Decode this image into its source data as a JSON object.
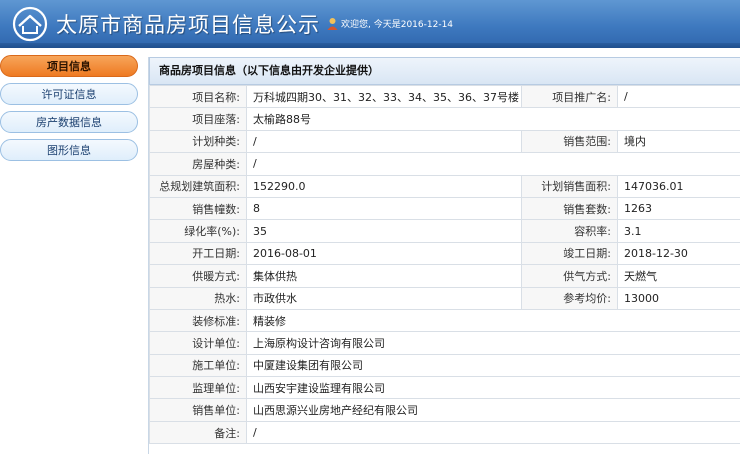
{
  "header": {
    "site_title": "太原市商品房项目信息公示",
    "welcome": "欢迎您, 今天是2016-12-14",
    "logo_icon": "house-circle-icon",
    "user_icon": "user-icon"
  },
  "sidebar": {
    "items": [
      {
        "label": "项目信息",
        "active": true
      },
      {
        "label": "许可证信息",
        "active": false
      },
      {
        "label": "房产数据信息",
        "active": false
      },
      {
        "label": "图形信息",
        "active": false
      }
    ]
  },
  "section": {
    "title": "商品房项目信息（以下信息由开发企业提供）"
  },
  "fields": {
    "project_name": {
      "label": "项目名称:",
      "value": "万科城四期30、31、32、33、34、35、36、37号楼"
    },
    "promo_name": {
      "label": "项目推广名:",
      "value": "/"
    },
    "location": {
      "label": "项目座落:",
      "value": "太榆路88号"
    },
    "plan_type": {
      "label": "计划种类:",
      "value": "/"
    },
    "sales_scope": {
      "label": "销售范围:",
      "value": "境内"
    },
    "house_type": {
      "label": "房屋种类:",
      "value": "/"
    },
    "total_area": {
      "label": "总规划建筑面积:",
      "value": "152290.0"
    },
    "plan_sales_area": {
      "label": "计划销售面积:",
      "value": "147036.01"
    },
    "building_count": {
      "label": "销售幢数:",
      "value": "8"
    },
    "unit_count": {
      "label": "销售套数:",
      "value": "1263"
    },
    "green_rate": {
      "label": "绿化率(%):",
      "value": "35"
    },
    "plot_ratio": {
      "label": "容积率:",
      "value": "3.1"
    },
    "start_date": {
      "label": "开工日期:",
      "value": "2016-08-01"
    },
    "finish_date": {
      "label": "竣工日期:",
      "value": "2018-12-30"
    },
    "heating": {
      "label": "供暖方式:",
      "value": "集体供热"
    },
    "gas": {
      "label": "供气方式:",
      "value": "天燃气"
    },
    "hot_water": {
      "label": "热水:",
      "value": "市政供水"
    },
    "ref_price": {
      "label": "参考均价:",
      "value": "13000"
    },
    "decoration": {
      "label": "装修标准:",
      "value": "精装修"
    },
    "design_unit": {
      "label": "设计单位:",
      "value": "上海原构设计咨询有限公司"
    },
    "construction_unit": {
      "label": "施工单位:",
      "value": "中厦建设集团有限公司"
    },
    "supervision_unit": {
      "label": "监理单位:",
      "value": "山西安宇建设监理有限公司"
    },
    "sales_unit": {
      "label": "销售单位:",
      "value": "山西思源兴业房地产经纪有限公司"
    },
    "remarks": {
      "label": "备注:",
      "value": "/"
    }
  }
}
